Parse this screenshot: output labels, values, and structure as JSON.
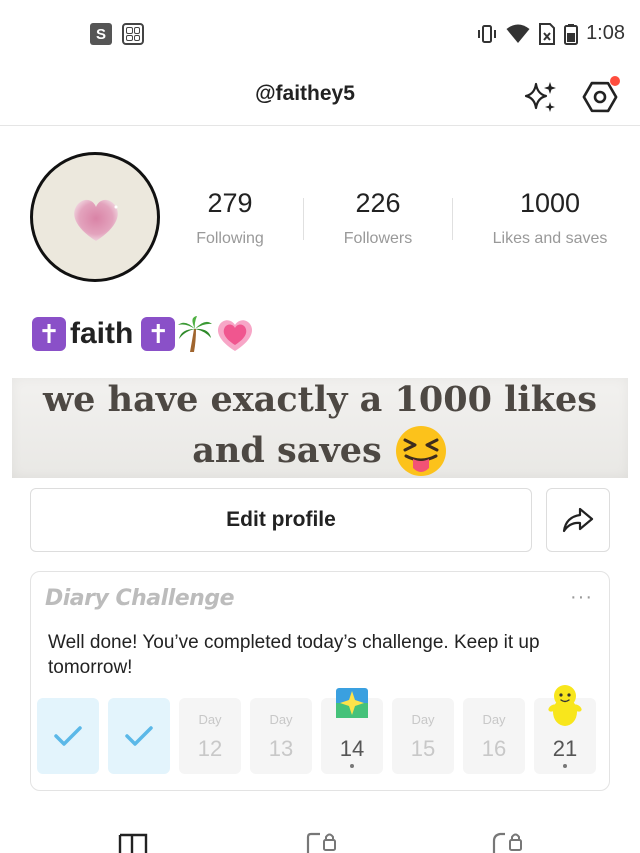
{
  "status_bar": {
    "left_icons": [
      "s-icon",
      "calculator-icon"
    ],
    "s_letter": "S",
    "right_icons": [
      "vibrate-icon",
      "wifi-icon",
      "sim-no-service-icon",
      "battery-icon"
    ],
    "time": "1:08"
  },
  "header": {
    "username": "@faithey5",
    "icons": [
      "sparkle-icon",
      "settings-hex-icon"
    ],
    "notification_dot_color": "#ff4d3d"
  },
  "profile": {
    "stats": [
      {
        "value": "279",
        "label": "Following"
      },
      {
        "value": "226",
        "label": "Followers"
      },
      {
        "value": "1000",
        "label": "Likes and saves"
      }
    ],
    "name": "faith",
    "name_emoji_cross": "✝",
    "name_emoji_palm": "🌴",
    "name_emoji_heart": "💗"
  },
  "overlay": {
    "line1": "we have exactly a 1000 likes",
    "line2": "and saves",
    "emoji": "😝"
  },
  "actions": {
    "edit_label": "Edit profile",
    "share_icon": "share-arrow-icon"
  },
  "diary": {
    "title": "Diary Challenge",
    "more": "···",
    "message": "Well done! You’ve completed today’s challenge. Keep it up tomorrow!",
    "days": [
      {
        "state": "done"
      },
      {
        "state": "done"
      },
      {
        "label": "Day",
        "num": "12"
      },
      {
        "label": "Day",
        "num": "13"
      },
      {
        "num": "14",
        "badge": "star-badge-icon"
      },
      {
        "label": "Day",
        "num": "15"
      },
      {
        "label": "Day",
        "num": "16"
      },
      {
        "num": "21",
        "badge": "yellow-mascot-icon"
      }
    ],
    "accent_color": "#5bb8e8"
  },
  "bottom_nav": {
    "icons": [
      "notes-tab-icon",
      "locked-collections-icon",
      "locked-likes-icon"
    ]
  }
}
